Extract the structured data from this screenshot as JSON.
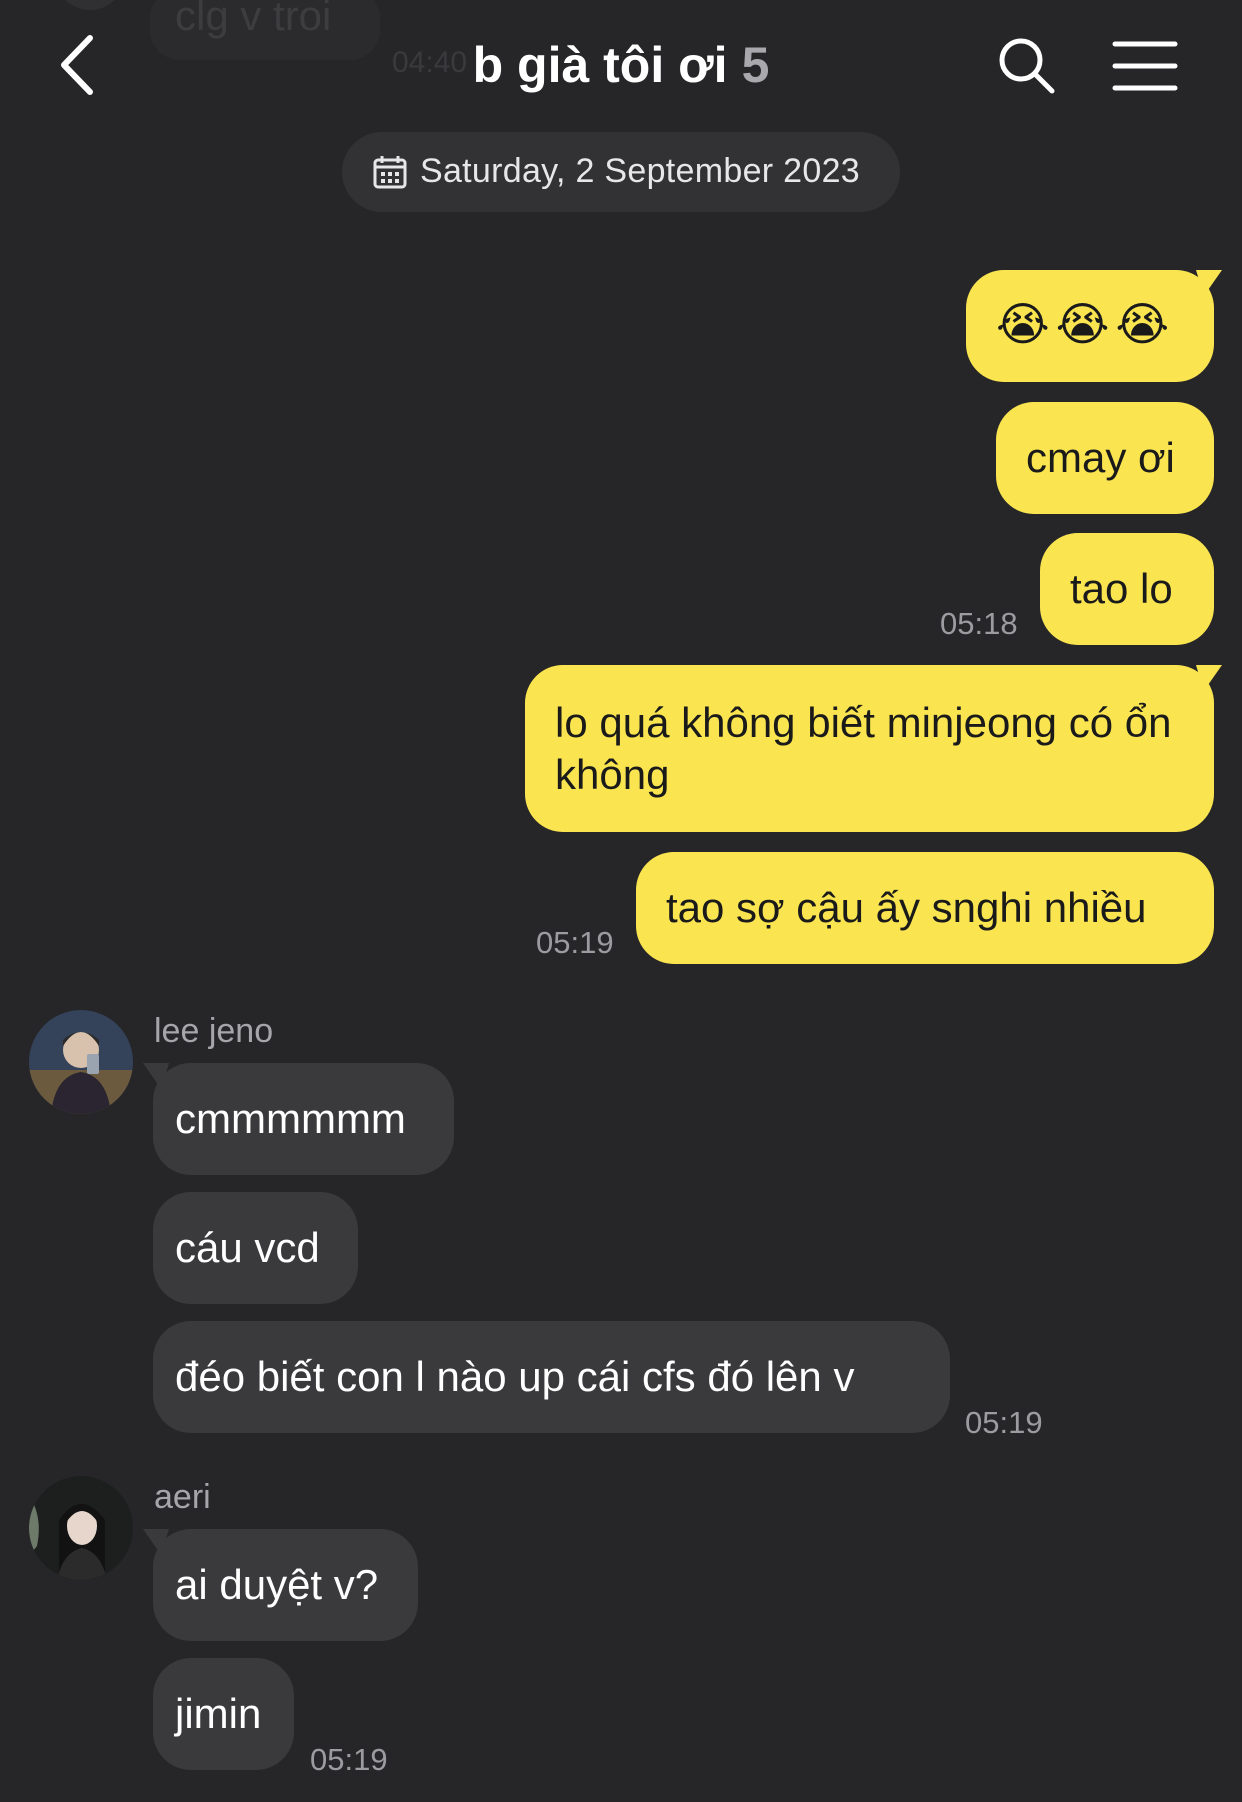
{
  "previous": {
    "text": "clg v troi",
    "time": "04:40"
  },
  "header": {
    "title": "b già tôi ơi",
    "member_count": "5"
  },
  "date_label": "Saturday, 2 September 2023",
  "messages": [
    {
      "text": "😭😭😭"
    },
    {
      "text": "cmay ơi"
    },
    {
      "text": "tao lo",
      "time": "05:18"
    },
    {
      "text": "lo quá không biết minjeong có ổn không"
    },
    {
      "text": "tao sợ cậu ấy snghi nhiều",
      "time": "05:19"
    },
    {
      "sender": "lee jeno",
      "text": "cmmmmmm"
    },
    {
      "text": "cáu vcd"
    },
    {
      "text": "đéo biết con l nào up cái cfs đó lên v",
      "time": "05:19"
    },
    {
      "sender": "aeri",
      "text": "ai duyệt v?"
    },
    {
      "text": "jimin",
      "time": "05:19"
    }
  ],
  "colors": {
    "background": "#262628",
    "my_bubble": "#fae550",
    "other_bubble": "#3a3a3c"
  }
}
